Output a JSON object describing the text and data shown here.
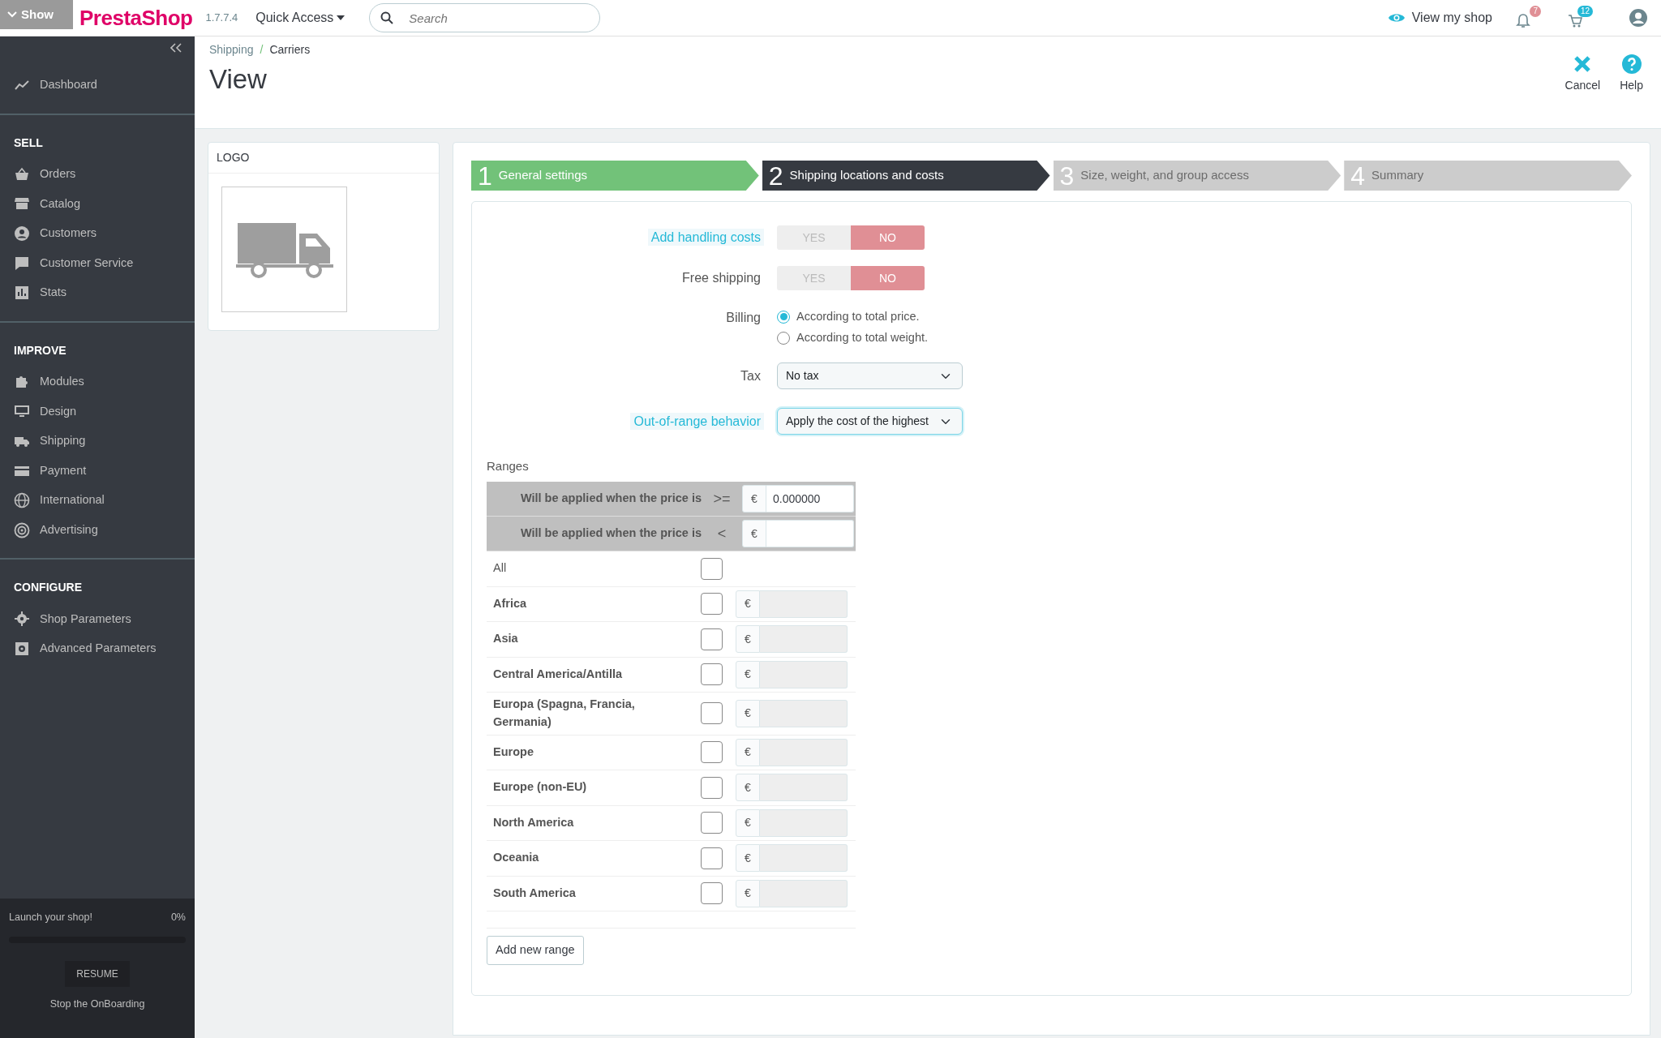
{
  "topbar": {
    "overlay_button": "Show",
    "logo": "PrestaShop",
    "version": "1.7.7.4",
    "quick_access": "Quick Access",
    "search": {
      "placeholder": "Search"
    },
    "view_shop": "View my shop",
    "notifications": [
      {
        "badge": "7",
        "color": "#e08f95"
      },
      {
        "badge": "12",
        "color": "#25b9d7"
      }
    ]
  },
  "sidebar": {
    "sections": [
      {
        "items": [
          {
            "label": "Dashboard"
          }
        ]
      },
      {
        "title": "SELL",
        "items": [
          {
            "label": "Orders"
          },
          {
            "label": "Catalog"
          },
          {
            "label": "Customers"
          },
          {
            "label": "Customer Service"
          },
          {
            "label": "Stats"
          }
        ]
      },
      {
        "title": "IMPROVE",
        "items": [
          {
            "label": "Modules"
          },
          {
            "label": "Design"
          },
          {
            "label": "Shipping"
          },
          {
            "label": "Payment"
          },
          {
            "label": "International"
          },
          {
            "label": "Advertising"
          }
        ]
      },
      {
        "title": "CONFIGURE",
        "items": [
          {
            "label": "Shop Parameters"
          },
          {
            "label": "Advanced Parameters"
          }
        ]
      }
    ],
    "onboarding": {
      "title": "Launch your shop!",
      "percent": "0%",
      "level": 0,
      "resume": "RESUME",
      "stop": "Stop the OnBoarding"
    }
  },
  "header": {
    "breadcrumb": [
      "Shipping",
      "Carriers"
    ],
    "breadcrumb_separator": "/",
    "title": "View",
    "toolbar": [
      {
        "label": "Cancel",
        "kind": "cancel"
      },
      {
        "label": "Help",
        "kind": "help"
      }
    ]
  },
  "logo_card": {
    "title": "LOGO"
  },
  "steps": [
    {
      "number": "1",
      "label": "General settings",
      "done": true,
      "selected": false
    },
    {
      "number": "2",
      "label": "Shipping locations and costs",
      "done": false,
      "selected": true
    },
    {
      "number": "3",
      "label": "Size, weight, and group access",
      "done": false,
      "selected": false
    },
    {
      "number": "4",
      "label": "Summary",
      "done": false,
      "selected": false
    }
  ],
  "form": [
    {
      "kind": "toggle",
      "label": "Add handling costs",
      "hint": true,
      "options": [
        {
          "label": "YES",
          "selected": false
        },
        {
          "label": "NO",
          "selected": true
        }
      ]
    },
    {
      "kind": "toggle",
      "label": "Free shipping",
      "hint": false,
      "options": [
        {
          "label": "YES",
          "selected": false
        },
        {
          "label": "NO",
          "selected": true
        }
      ]
    },
    {
      "kind": "radio",
      "label": "Billing",
      "hint": false,
      "options": [
        {
          "label": "According to total price.",
          "selected": true
        },
        {
          "label": "According to total weight.",
          "selected": false
        }
      ]
    },
    {
      "kind": "select",
      "label": "Tax",
      "hint": false,
      "value": "No tax",
      "focused": false
    },
    {
      "kind": "select",
      "label": "Out-of-range behavior",
      "hint": true,
      "value": "Apply the cost of the highest",
      "focused": true
    }
  ],
  "ranges": {
    "title": "Ranges",
    "bounds": [
      {
        "label": "Will be applied when the price is",
        "operator": ">=",
        "currency": "€",
        "value": "0.000000"
      },
      {
        "label": "Will be applied when the price is",
        "operator": "<",
        "currency": "€"
      }
    ],
    "zones": [
      {
        "name": "All",
        "kind": "all",
        "checked": false
      },
      {
        "name": "Africa",
        "kind": "zone",
        "checked": false,
        "currency": "€"
      },
      {
        "name": "Asia",
        "kind": "zone",
        "checked": false,
        "currency": "€"
      },
      {
        "name": "Central America/Antilla",
        "kind": "zone",
        "checked": false,
        "currency": "€"
      },
      {
        "name": "Europa (Spagna, Francia, Germania)",
        "kind": "zone",
        "checked": false,
        "currency": "€"
      },
      {
        "name": "Europe",
        "kind": "zone",
        "checked": false,
        "currency": "€"
      },
      {
        "name": "Europe (non-EU)",
        "kind": "zone",
        "checked": false,
        "currency": "€"
      },
      {
        "name": "North America",
        "kind": "zone",
        "checked": false,
        "currency": "€"
      },
      {
        "name": "Oceania",
        "kind": "zone",
        "checked": false,
        "currency": "€"
      },
      {
        "name": "South America",
        "kind": "zone",
        "checked": false,
        "currency": "€"
      }
    ],
    "add_button": "Add new range"
  }
}
